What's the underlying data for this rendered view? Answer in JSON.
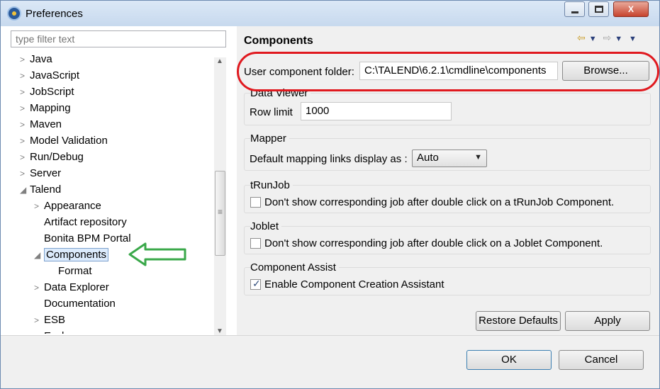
{
  "window": {
    "title": "Preferences",
    "controls": {
      "minimize": "",
      "maximize": "",
      "close": "X"
    }
  },
  "filter": {
    "placeholder": "type filter text"
  },
  "tree": [
    {
      "label": "Java",
      "arrow": ">",
      "level": 0
    },
    {
      "label": "JavaScript",
      "arrow": ">",
      "level": 0
    },
    {
      "label": "JobScript",
      "arrow": ">",
      "level": 0
    },
    {
      "label": "Mapping",
      "arrow": ">",
      "level": 0
    },
    {
      "label": "Maven",
      "arrow": ">",
      "level": 0
    },
    {
      "label": "Model Validation",
      "arrow": ">",
      "level": 0
    },
    {
      "label": "Run/Debug",
      "arrow": ">",
      "level": 0
    },
    {
      "label": "Server",
      "arrow": ">",
      "level": 0
    },
    {
      "label": "Talend",
      "arrow": "◢",
      "level": 0
    },
    {
      "label": "Appearance",
      "arrow": ">",
      "level": 1
    },
    {
      "label": "Artifact repository",
      "arrow": "",
      "level": 1
    },
    {
      "label": "Bonita BPM Portal",
      "arrow": "",
      "level": 1
    },
    {
      "label": "Components",
      "arrow": "◢",
      "level": 1,
      "selected": true
    },
    {
      "label": "Format",
      "arrow": "",
      "level": 2
    },
    {
      "label": "Data Explorer",
      "arrow": ">",
      "level": 1
    },
    {
      "label": "Documentation",
      "arrow": "",
      "level": 1
    },
    {
      "label": "ESB",
      "arrow": ">",
      "level": 1
    },
    {
      "label": "Exchange",
      "arrow": ">",
      "level": 1
    }
  ],
  "page": {
    "title": "Components",
    "user_component_folder": {
      "label": "User component folder:",
      "value": "C:\\TALEND\\6.2.1\\cmdline\\components",
      "browse": "Browse..."
    },
    "data_viewer": {
      "title": "Data Viewer",
      "row_limit_label": "Row limit",
      "row_limit_value": "1000"
    },
    "mapper": {
      "title": "Mapper",
      "display_label": "Default mapping links display as :",
      "display_value": "Auto"
    },
    "trunjob": {
      "title": "tRunJob",
      "checkbox_label": "Don't show corresponding job after double click on a tRunJob Component.",
      "checked": false
    },
    "joblet": {
      "title": "Joblet",
      "checkbox_label": "Don't show corresponding job after double click on a Joblet Component.",
      "checked": false
    },
    "component_assist": {
      "title": "Component Assist",
      "checkbox_label": "Enable Component Creation Assistant",
      "checked": true
    },
    "restore_defaults": "Restore Defaults",
    "apply": "Apply"
  },
  "footer": {
    "ok": "OK",
    "cancel": "Cancel"
  },
  "annotation_colors": {
    "oval": "#e0191f",
    "arrow": "#3aa84a"
  }
}
